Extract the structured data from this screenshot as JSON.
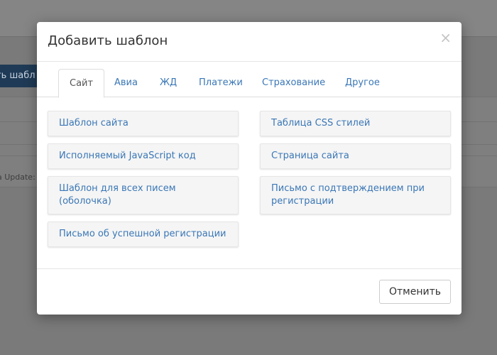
{
  "background": {
    "button_label": "ть шабл",
    "status_text": "a Update:"
  },
  "modal": {
    "title": "Добавить шаблон",
    "close_symbol": "×",
    "tabs": [
      {
        "label": "Сайт",
        "active": true
      },
      {
        "label": "Авиа",
        "active": false
      },
      {
        "label": "ЖД",
        "active": false
      },
      {
        "label": "Платежи",
        "active": false
      },
      {
        "label": "Страхование",
        "active": false
      },
      {
        "label": "Другое",
        "active": false
      }
    ],
    "templates": [
      {
        "label": "Шаблон сайта"
      },
      {
        "label": "Таблица CSS стилей"
      },
      {
        "label": "Исполняемый JavaScript код"
      },
      {
        "label": "Страница сайта"
      },
      {
        "label": "Шаблон для всех писем (оболочка)"
      },
      {
        "label": "Письмо с подтверждением при регистрации"
      },
      {
        "label": "Письмо об успешной регистрации"
      }
    ],
    "cancel_label": "Отменить"
  },
  "colors": {
    "link": "#3a77b6",
    "backdrop": "#7a7a7a"
  }
}
